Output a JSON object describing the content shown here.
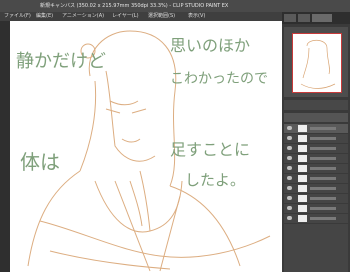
{
  "window": {
    "title": "新規キャンバス (350.02 x 215.97mm 350dpi 33.3%) - CLIP STUDIO PAINT EX"
  },
  "menu": [
    "ファイル(F)",
    "編集(E)",
    "アニメーション(A)",
    "レイヤー(L)",
    "選択範囲(S)",
    "表示(V)"
  ],
  "canvas": {
    "text_left_1": "静かだけど",
    "text_left_2": "体は",
    "text_right_1": "思いのほか",
    "text_right_2": "こわかったので",
    "text_right_3": "足すことに",
    "text_right_4": "したよ。"
  },
  "colors": {
    "sketch": "#d9a574",
    "ink_green": "#7fa07b",
    "dock_bg": "#3a3a3a"
  }
}
